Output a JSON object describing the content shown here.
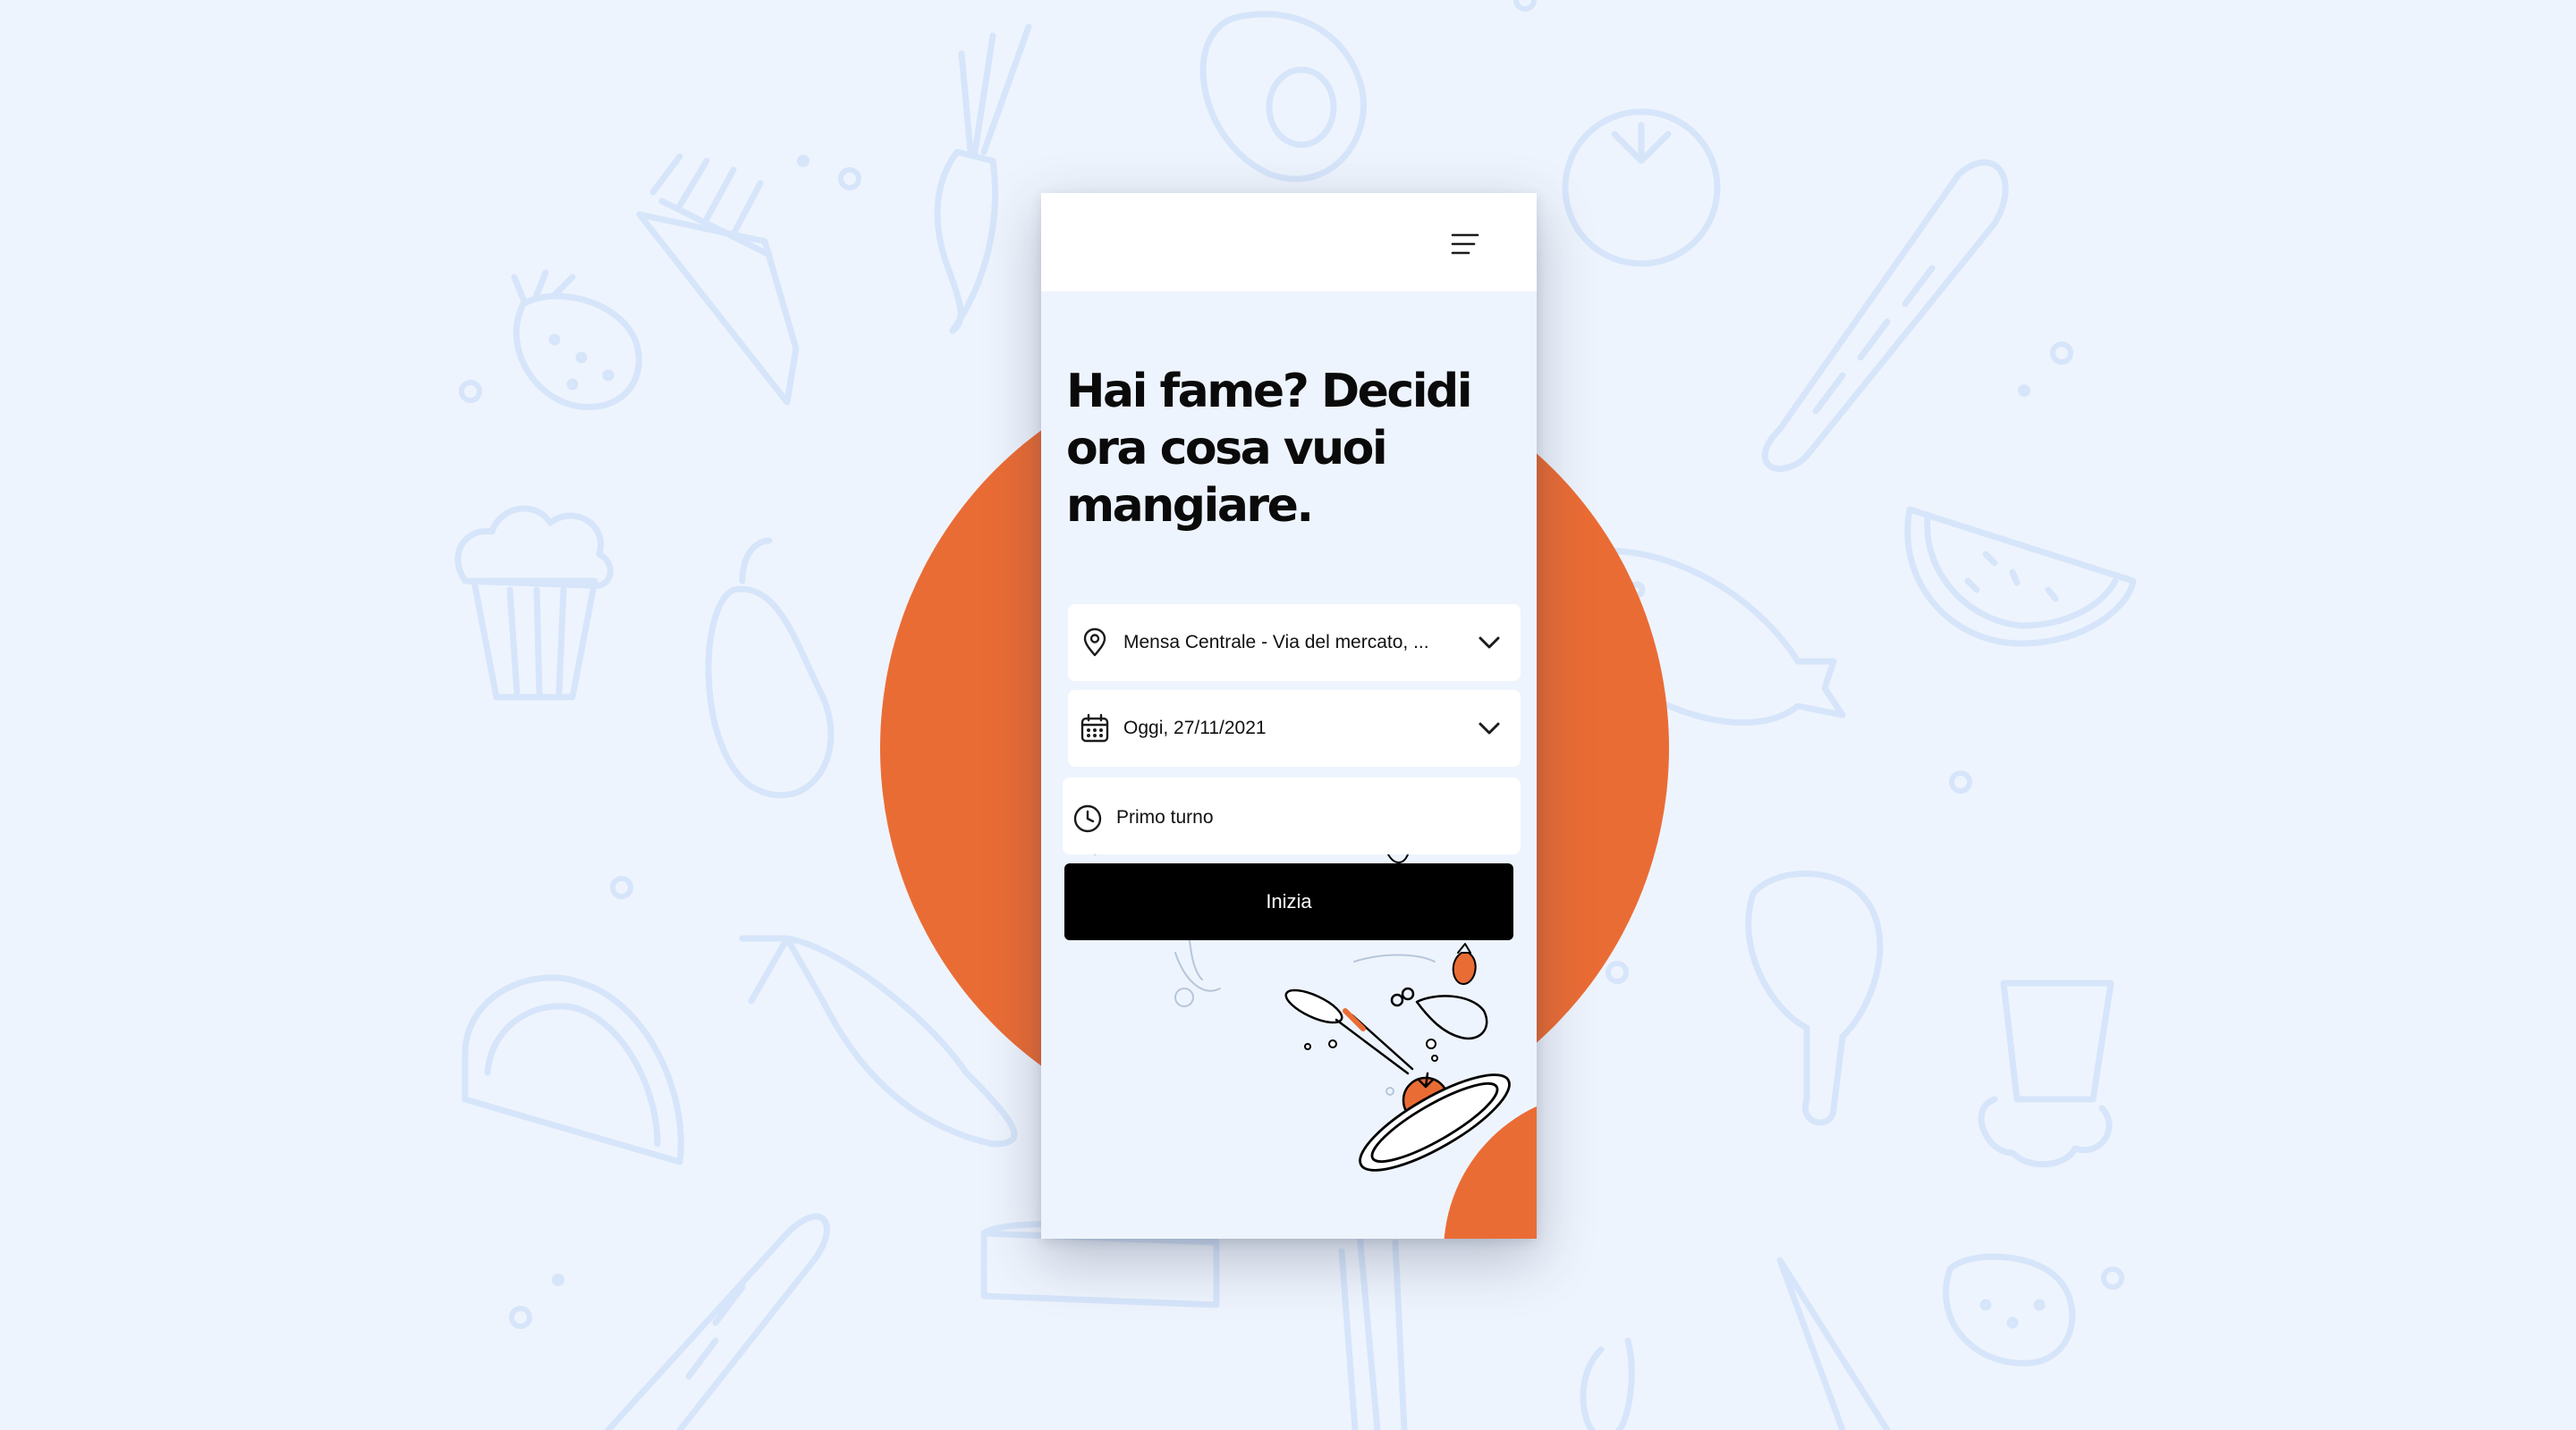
{
  "app": {
    "menu_icon": "hamburger-menu-icon"
  },
  "hero": {
    "headline": "Hai fame? Decidi ora cosa vuoi mangiare."
  },
  "form": {
    "location": {
      "icon": "map-pin-icon",
      "value": "Mensa Centrale - Via del mercato, ...",
      "chevron": "chevron-down-icon"
    },
    "date": {
      "icon": "calendar-icon",
      "value": "Oggi, 27/11/2021",
      "chevron": "chevron-down-icon"
    },
    "shift": {
      "icon": "clock-icon",
      "value": "Primo turno"
    },
    "submit_label": "Inizia"
  },
  "colors": {
    "accent": "#ea6c35",
    "background": "#eef4fd",
    "doodle": "#d6e5fa",
    "button": "#000000",
    "text": "#0a0a0a"
  }
}
